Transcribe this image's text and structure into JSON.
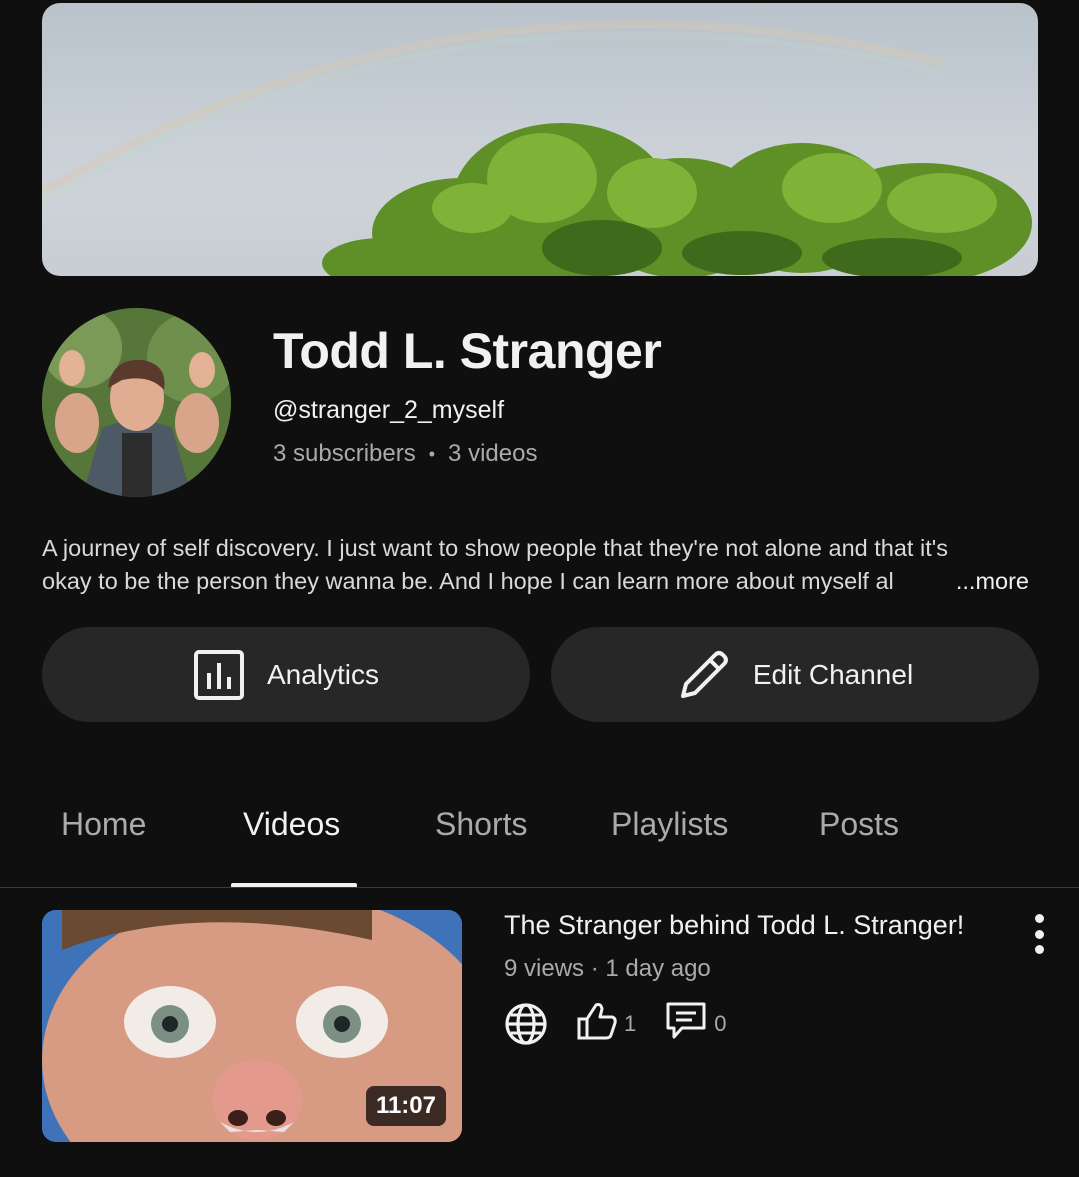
{
  "channel": {
    "name": "Todd L. Stranger",
    "handle": "@stranger_2_myself",
    "subscribers": "3 subscribers",
    "separator": "•",
    "videos": "3 videos",
    "description_line1": "A journey of self discovery. I just want to show people that they're not alone and that it's",
    "description_line2": "okay to be the person they wanna be. And I hope I can learn more about myself al",
    "more_label": "...more"
  },
  "actions": {
    "analytics_label": "Analytics",
    "analytics_icon": "analytics-icon",
    "edit_label": "Edit Channel",
    "edit_icon": "pencil-icon"
  },
  "tabs": [
    {
      "label": "Home",
      "active": false
    },
    {
      "label": "Videos",
      "active": true
    },
    {
      "label": "Shorts",
      "active": false
    },
    {
      "label": "Playlists",
      "active": false
    },
    {
      "label": "Posts",
      "active": false
    }
  ],
  "videos": [
    {
      "title": "The Stranger behind Todd L. Stranger!",
      "meta": "9 views · 1 day ago",
      "duration": "11:07",
      "visibility_icon": "globe-icon",
      "likes": "1",
      "comments": "0"
    }
  ],
  "colors": {
    "background": "#0f0f0f",
    "button_bg": "#272727",
    "text_primary": "#f1f1f1",
    "text_secondary": "#aaaaaa"
  }
}
